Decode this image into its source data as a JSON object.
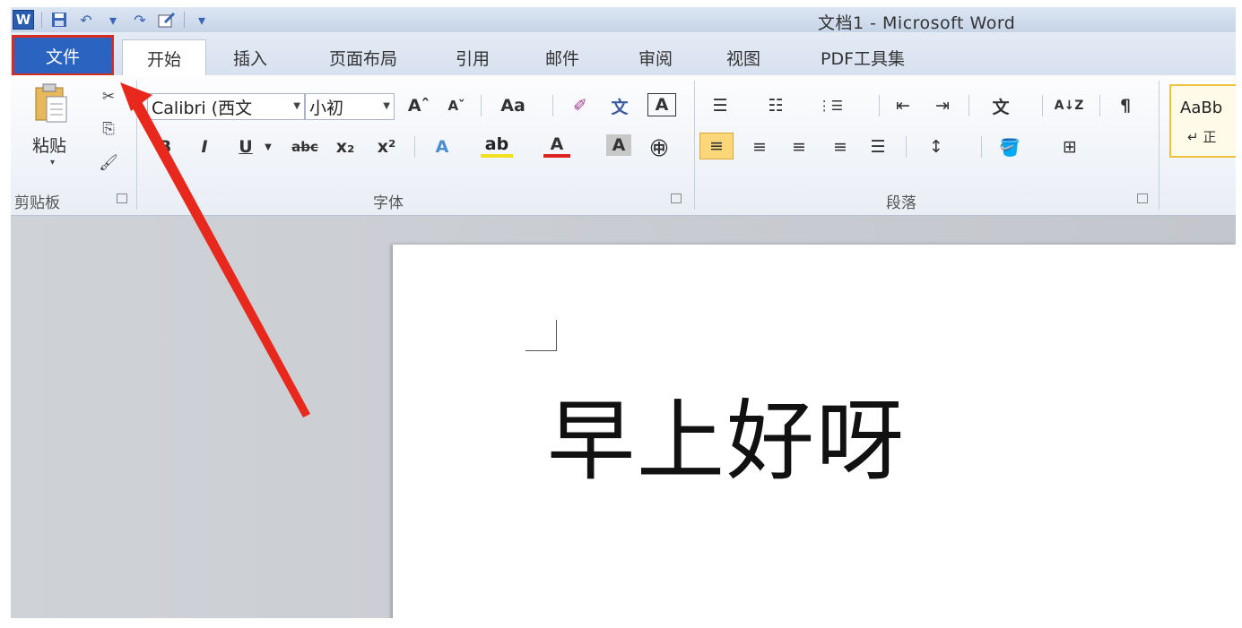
{
  "title_bar": {
    "title": "文档1 - Microsoft Word",
    "logo_letter": "W"
  },
  "qat": {
    "save": "💾",
    "undo": "↶",
    "redo": "↷",
    "customize": "▾"
  },
  "tabs": {
    "file": "文件",
    "items": [
      "开始",
      "插入",
      "页面布局",
      "引用",
      "邮件",
      "审阅",
      "视图",
      "PDF工具集"
    ]
  },
  "clipboard": {
    "paste_label": "粘贴",
    "paste_arrow": "▾",
    "cut_icon": "✂",
    "copy_icon": "⎘",
    "format_painter_icon": "🖌",
    "group_label": "剪贴板"
  },
  "font": {
    "font_name": "Calibri (西文",
    "font_size": "小初",
    "grow": "Aˆ",
    "shrink": "Aˇ",
    "change_case": "Aa",
    "clear_format": "✐",
    "phonetic": "文",
    "border": "A",
    "bold": "B",
    "italic": "I",
    "underline": "U",
    "strike": "abc",
    "subscript": "x₂",
    "superscript": "x²",
    "text_effect": "A",
    "highlight": "ab",
    "font_color": "A",
    "shading": "A",
    "enclose": "㊥",
    "group_label": "字体"
  },
  "paragraph": {
    "bullets": "☰",
    "numbering": "☷",
    "multilevel": "⋮☰",
    "decrease_indent": "⇤",
    "increase_indent": "⇥",
    "chinese_layout": "文",
    "sort": "A↓Z",
    "show_marks": "¶",
    "align_left": "≡",
    "center": "≡",
    "align_right": "≡",
    "justify": "≡",
    "distributed": "☰",
    "line_spacing": "↕",
    "shading": "🪣",
    "borders": "⊞",
    "group_label": "段落"
  },
  "styles": {
    "preview": "AaBb",
    "normal": "↵ 正"
  },
  "document": {
    "text": "早上好呀"
  },
  "colors": {
    "file_tab": "#2b64c0",
    "highlight_box": "#d62c22",
    "arrow": "#e8281c"
  }
}
